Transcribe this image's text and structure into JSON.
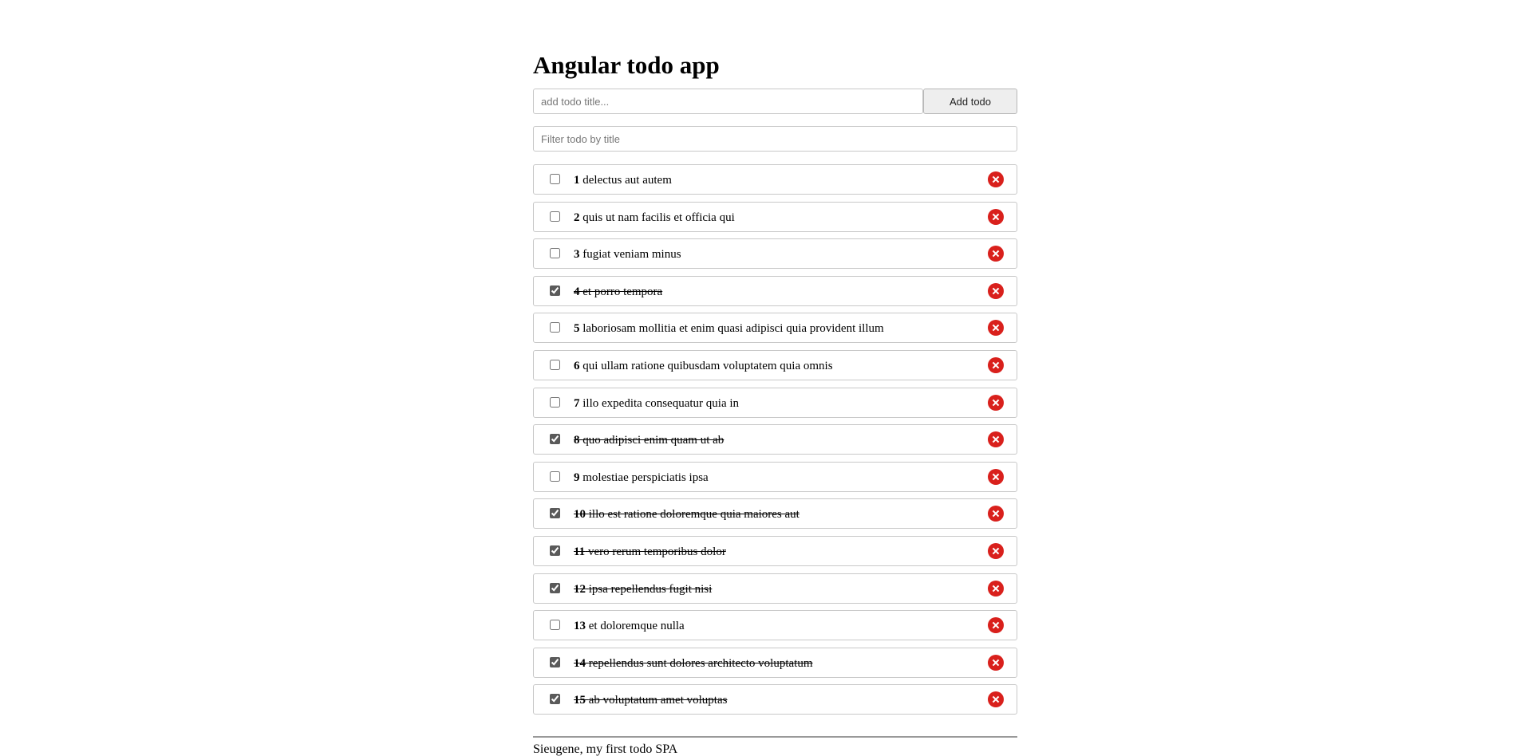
{
  "app": {
    "title": "Angular todo app"
  },
  "add_form": {
    "placeholder": "add todo title...",
    "value": "",
    "button_label": "Add todo"
  },
  "filter": {
    "placeholder": "Filter todo by title",
    "value": ""
  },
  "todos": [
    {
      "id": "1",
      "title": "delectus aut autem",
      "completed": false
    },
    {
      "id": "2",
      "title": "quis ut nam facilis et officia qui",
      "completed": false
    },
    {
      "id": "3",
      "title": "fugiat veniam minus",
      "completed": false
    },
    {
      "id": "4",
      "title": "et porro tempora",
      "completed": true
    },
    {
      "id": "5",
      "title": "laboriosam mollitia et enim quasi adipisci quia provident illum",
      "completed": false
    },
    {
      "id": "6",
      "title": "qui ullam ratione quibusdam voluptatem quia omnis",
      "completed": false
    },
    {
      "id": "7",
      "title": "illo expedita consequatur quia in",
      "completed": false
    },
    {
      "id": "8",
      "title": "quo adipisci enim quam ut ab",
      "completed": true
    },
    {
      "id": "9",
      "title": "molestiae perspiciatis ipsa",
      "completed": false
    },
    {
      "id": "10",
      "title": "illo est ratione doloremque quia maiores aut",
      "completed": true
    },
    {
      "id": "11",
      "title": "vero rerum temporibus dolor",
      "completed": true
    },
    {
      "id": "12",
      "title": "ipsa repellendus fugit nisi",
      "completed": true
    },
    {
      "id": "13",
      "title": "et doloremque nulla",
      "completed": false
    },
    {
      "id": "14",
      "title": "repellendus sunt dolores architecto voluptatum",
      "completed": true
    },
    {
      "id": "15",
      "title": "ab voluptatum amet voluptas",
      "completed": true
    }
  ],
  "icons": {
    "delete": "close-circle-icon"
  },
  "colors": {
    "delete_button": "#d9201c"
  },
  "footer": {
    "text": "Sieugene, my first todo SPA"
  }
}
